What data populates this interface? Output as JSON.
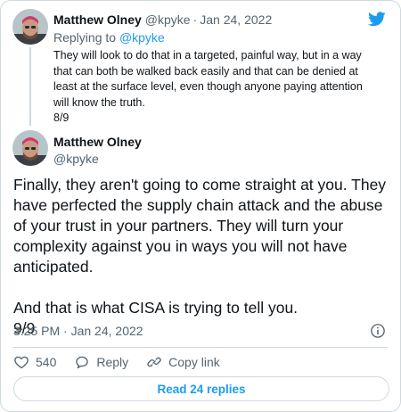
{
  "parent_tweet": {
    "name": "Matthew Olney",
    "handle": "@kpyke",
    "separator": "·",
    "date": "Jan 24, 2022",
    "replying_prefix": "Replying to",
    "replying_to": "@kpyke",
    "text": "They will look to do that in a targeted, painful way, but in a way that can both be walked back easily and that can be denied at least at the surface level, even though anyone paying attention will know the truth.\n8/9"
  },
  "main_tweet": {
    "name": "Matthew Olney",
    "handle": "@kpyke",
    "text": "Finally, they aren't going to come straight at you. They have perfected the supply chain attack and the abuse of your trust in your partners. They will turn your complexity against you in ways you will not have anticipated.\n\nAnd that is what CISA is trying to tell you.\n9/9",
    "time": "3:25 PM",
    "separator": "·",
    "date": "Jan 24, 2022"
  },
  "actions": {
    "like_count": "540",
    "reply_label": "Reply",
    "copy_link_label": "Copy link"
  },
  "read_replies_label": "Read 24 replies",
  "icons": {
    "brand": "twitter-bird-icon",
    "info": "info-icon",
    "like": "heart-icon",
    "reply": "speech-bubble-icon",
    "copy": "link-icon"
  },
  "colors": {
    "accent": "#1d9bf0",
    "text": "#0f1419",
    "muted": "#536471",
    "border": "#cfd9de"
  }
}
